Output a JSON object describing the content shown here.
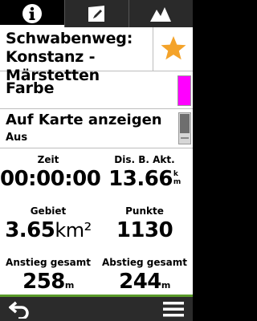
{
  "tabs": [
    {
      "icon": "info-icon",
      "active": true
    },
    {
      "icon": "map-edit-icon",
      "active": false
    },
    {
      "icon": "elevation-profile-icon",
      "active": false
    }
  ],
  "track": {
    "name": "Schwabenweg: Konstanz - Märstetten"
  },
  "color": {
    "label": "Farbe",
    "value_hex": "#ff00ff"
  },
  "show_on_map": {
    "label": "Auf Karte anzeigen",
    "value": "Aus"
  },
  "stats": {
    "time": {
      "label": "Zeit",
      "value": "00:00:00"
    },
    "distance": {
      "label": "Dis. B. Akt.",
      "value": "13.66",
      "unit_top": "k",
      "unit_bottom": "m"
    },
    "area": {
      "label": "Gebiet",
      "value": "3.65",
      "unit": "km²"
    },
    "points": {
      "label": "Punkte",
      "value": "1130"
    },
    "ascent": {
      "label": "Anstieg gesamt",
      "value": "258",
      "unit": "m"
    },
    "descent": {
      "label": "Abstieg gesamt",
      "value": "244",
      "unit": "m"
    }
  },
  "colors": {
    "accent_bar": "#5a9a2a",
    "star": "#f4a32a"
  }
}
